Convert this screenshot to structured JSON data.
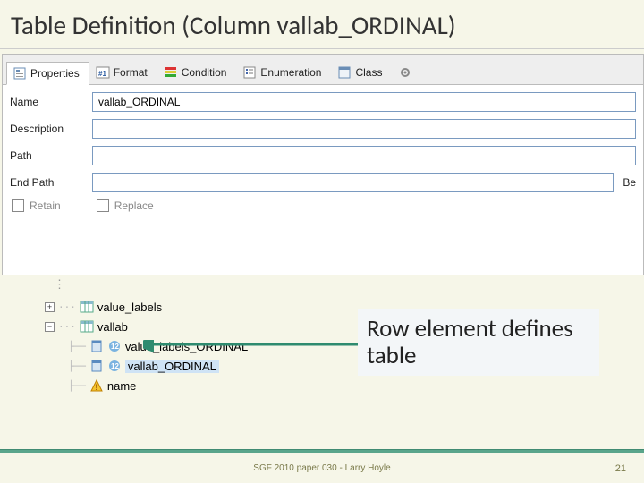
{
  "title": "Table Definition (Column vallab_ORDINAL)",
  "tabs": [
    {
      "label": "Properties"
    },
    {
      "label": "Format"
    },
    {
      "label": "Condition"
    },
    {
      "label": "Enumeration"
    },
    {
      "label": "Class"
    }
  ],
  "form": {
    "name_label": "Name",
    "name_value": "vallab_ORDINAL",
    "description_label": "Description",
    "description_value": "",
    "path_label": "Path",
    "path_value": "",
    "endpath_label": "End Path",
    "endpath_value": "",
    "beg_label": "Be",
    "retain_label": "Retain",
    "replace_label": "Replace"
  },
  "tree": {
    "nodes": [
      {
        "label": "value_labels"
      },
      {
        "label": "vallab"
      },
      {
        "label": "value_labels_ORDINAL"
      },
      {
        "label": "vallab_ORDINAL"
      },
      {
        "label": "name"
      }
    ]
  },
  "callout": "Row element defines table",
  "footer": "SGF 2010 paper 030 - Larry Hoyle",
  "page": "21"
}
